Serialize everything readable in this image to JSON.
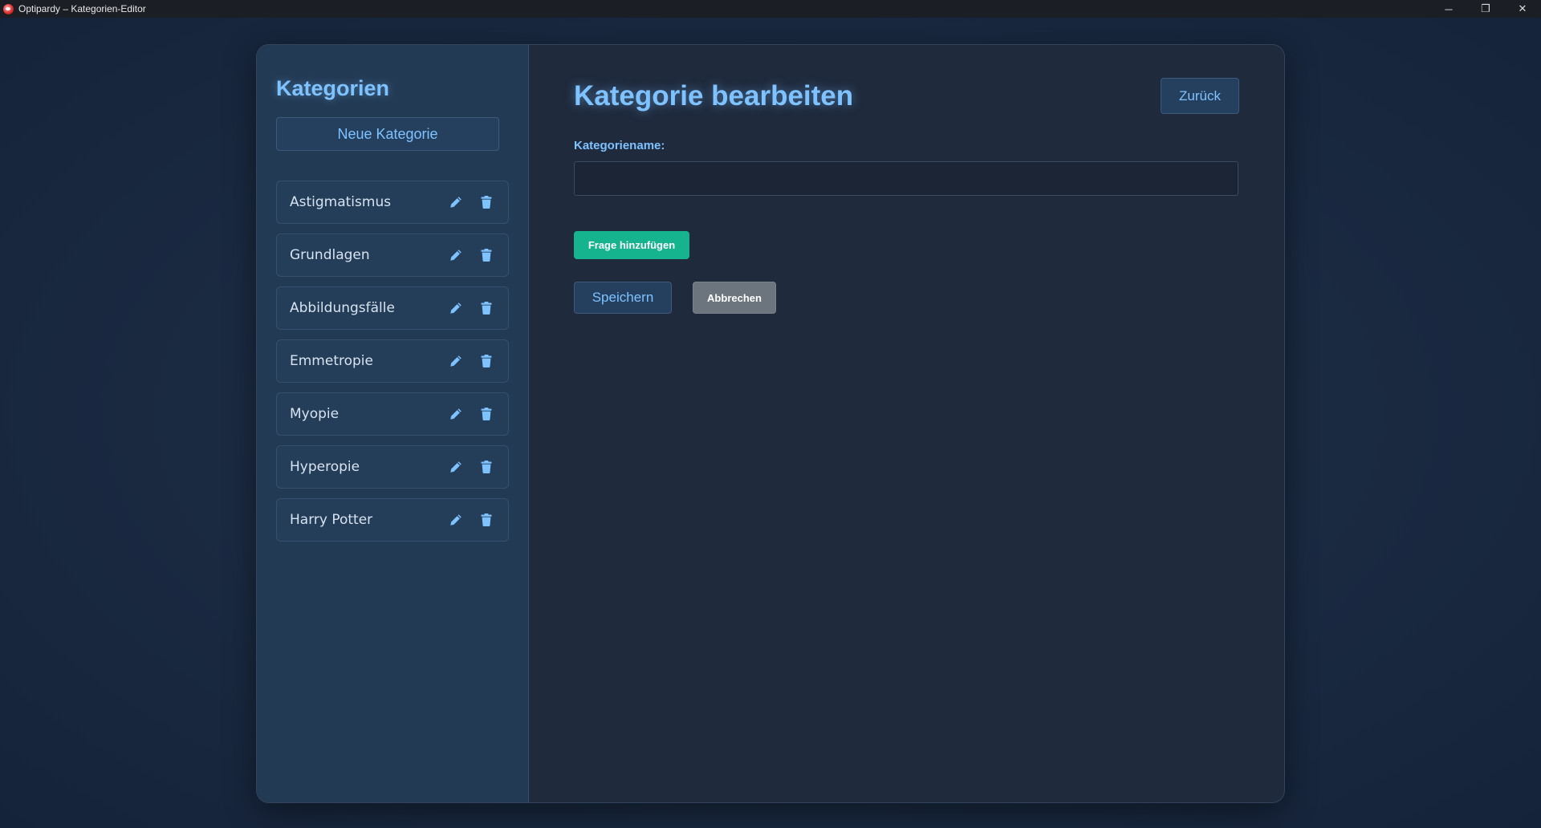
{
  "window": {
    "title": "Optipardy – Kategorien-Editor",
    "minimize_glyph": "─",
    "restore_glyph": "❐",
    "close_glyph": "✕"
  },
  "sidebar": {
    "title": "Kategorien",
    "new_button_label": "Neue Kategorie",
    "items": [
      {
        "label": "Astigmatismus"
      },
      {
        "label": "Grundlagen"
      },
      {
        "label": "Abbildungsfälle"
      },
      {
        "label": "Emmetropie"
      },
      {
        "label": "Myopie"
      },
      {
        "label": "Hyperopie"
      },
      {
        "label": "Harry Potter"
      }
    ],
    "item_icons": [
      "pencil-icon",
      "trash-icon"
    ]
  },
  "editor": {
    "title": "Kategorie bearbeiten",
    "back_label": "Zurück",
    "name_label": "Kategoriename:",
    "name_value": "",
    "add_question_label": "Frage hinzufügen",
    "save_label": "Speichern",
    "cancel_label": "Abbrechen"
  },
  "colors": {
    "accent": "#7ec2ff",
    "success": "#16b38f",
    "secondary": "#6c757d",
    "background": "#1b2b42",
    "sidebar": "#233a54",
    "panel": "#1f2a3c"
  }
}
